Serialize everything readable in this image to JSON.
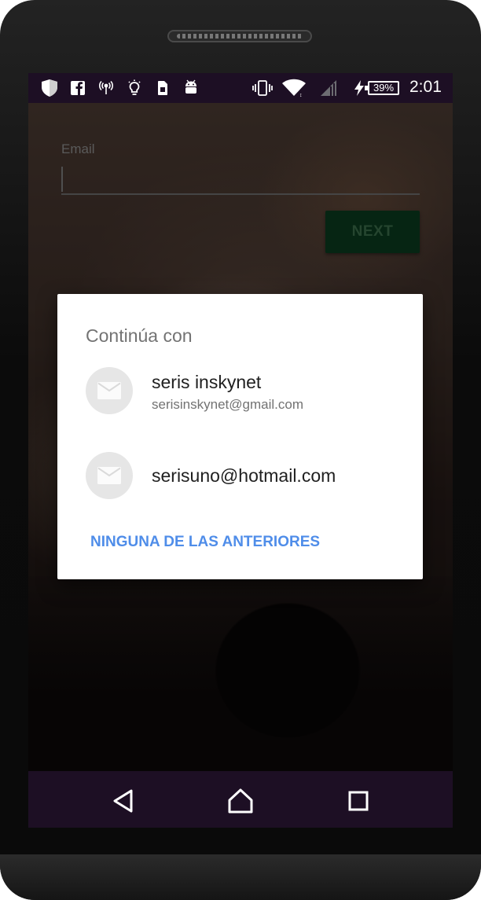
{
  "status_bar": {
    "icons": [
      "shield-icon",
      "facebook-icon",
      "broadcast-icon",
      "lightbulb-icon",
      "sim-card-icon",
      "android-icon",
      "vibrate-icon",
      "wifi-icon",
      "signal-icon",
      "charging-icon"
    ],
    "battery": "39%",
    "time": "2:01"
  },
  "form": {
    "email_label": "Email",
    "email_value": "",
    "next_label": "NEXT"
  },
  "dialog": {
    "title": "Continúa con",
    "accounts": [
      {
        "name": "seris inskynet",
        "email": "serisinskynet@gmail.com",
        "icon": "mail-icon"
      },
      {
        "name": "serisuno@hotmail.com",
        "icon": "mail-icon"
      }
    ],
    "none_label": "NINGUNA DE LAS ANTERIORES"
  },
  "nav_bar": {
    "icons": [
      "back-icon",
      "home-icon",
      "recents-icon"
    ]
  },
  "colors": {
    "status_bar": "#1d0f24",
    "next_button": "#0a3a1e",
    "dialog_link": "#4f8de9"
  }
}
